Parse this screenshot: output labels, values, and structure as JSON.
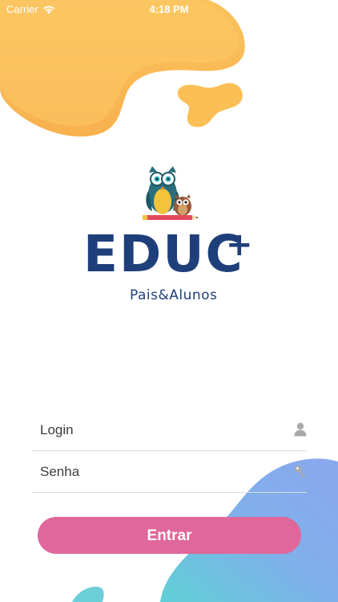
{
  "status_bar": {
    "carrier": "Carrier",
    "time": "4:18 PM",
    "icons": [
      "wifi-icon"
    ]
  },
  "logo": {
    "brand": "EDUC",
    "plus": "+",
    "subtitle": "Pais&Alunos",
    "mascot": "owl-mascot-logo"
  },
  "form": {
    "login": {
      "placeholder": "Login",
      "value": "",
      "icon": "user-icon"
    },
    "senha": {
      "placeholder": "Senha",
      "value": "",
      "icon": "key-icon"
    },
    "submit_label": "Entrar"
  },
  "colors": {
    "brand_blue": "#1f3f7a",
    "button_pink": "#e0679b",
    "blob_yellow": "#fbc35c",
    "blob_blue": "#7fb0ea",
    "blob_teal": "#66c8d9"
  }
}
